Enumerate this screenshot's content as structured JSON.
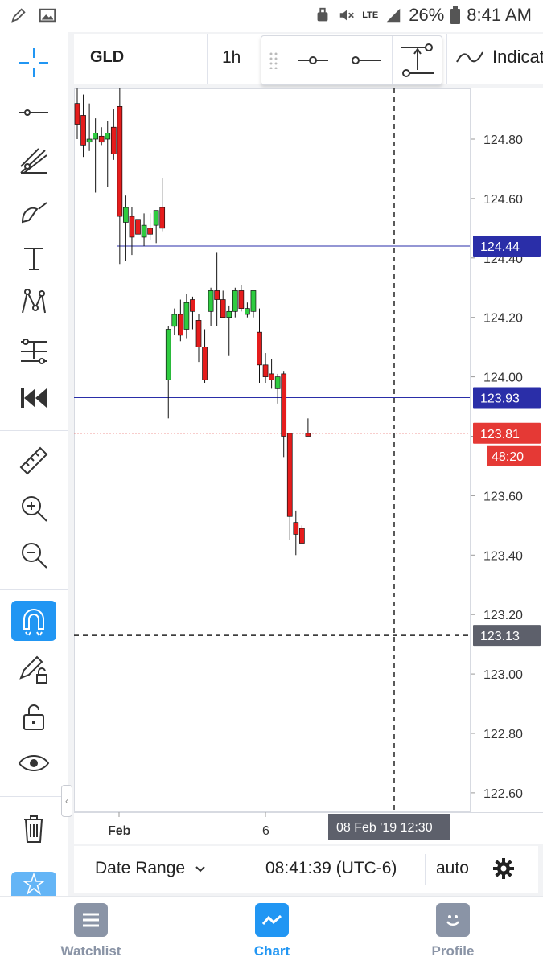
{
  "status_bar": {
    "battery": "26%",
    "time": "8:41 AM",
    "network": "LTE"
  },
  "top_toolbar": {
    "symbol": "GLD",
    "interval": "1h",
    "indicators_label": "Indicators"
  },
  "price_axis": {
    "ticks": [
      "124.80",
      "124.60",
      "124.40",
      "124.20",
      "124.00",
      "123.80",
      "123.60",
      "123.40",
      "123.20",
      "123.00",
      "122.80",
      "122.60"
    ],
    "labels": {
      "line_upper": "124.44",
      "line_lower": "123.93",
      "last_price": "123.81",
      "countdown": "48:20",
      "crosshair_price": "123.13"
    }
  },
  "time_axis": {
    "labels": [
      "Feb",
      "6"
    ],
    "crosshair_time": "08 Feb '19   12:30"
  },
  "chart_data": {
    "type": "candlestick",
    "symbol": "GLD",
    "interval": "1h",
    "ylim": [
      122.55,
      124.98
    ],
    "candles": [
      {
        "o": 124.92,
        "h": 124.97,
        "l": 124.8,
        "c": 124.85
      },
      {
        "o": 124.88,
        "h": 124.95,
        "l": 124.74,
        "c": 124.78
      },
      {
        "o": 124.79,
        "h": 124.92,
        "l": 124.76,
        "c": 124.8
      },
      {
        "o": 124.8,
        "h": 124.87,
        "l": 124.62,
        "c": 124.82
      },
      {
        "o": 124.81,
        "h": 124.84,
        "l": 124.78,
        "c": 124.79
      },
      {
        "o": 124.8,
        "h": 124.86,
        "l": 124.64,
        "c": 124.82
      },
      {
        "o": 124.84,
        "h": 124.9,
        "l": 124.73,
        "c": 124.75
      },
      {
        "o": 124.91,
        "h": 124.99,
        "l": 124.38,
        "c": 124.54
      },
      {
        "o": 124.52,
        "h": 124.61,
        "l": 124.39,
        "c": 124.57
      },
      {
        "o": 124.54,
        "h": 124.57,
        "l": 124.41,
        "c": 124.47
      },
      {
        "o": 124.53,
        "h": 124.59,
        "l": 124.43,
        "c": 124.48
      },
      {
        "o": 124.47,
        "h": 124.55,
        "l": 124.44,
        "c": 124.51
      },
      {
        "o": 124.5,
        "h": 124.55,
        "l": 124.46,
        "c": 124.48
      },
      {
        "o": 124.51,
        "h": 124.56,
        "l": 124.45,
        "c": 124.56
      },
      {
        "o": 124.57,
        "h": 124.67,
        "l": 124.49,
        "c": 124.5
      },
      {
        "o": 123.99,
        "h": 124.17,
        "l": 123.86,
        "c": 124.16
      },
      {
        "o": 124.17,
        "h": 124.23,
        "l": 124.14,
        "c": 124.21
      },
      {
        "o": 124.21,
        "h": 124.26,
        "l": 124.12,
        "c": 124.14
      },
      {
        "o": 124.16,
        "h": 124.28,
        "l": 124.13,
        "c": 124.25
      },
      {
        "o": 124.26,
        "h": 124.27,
        "l": 124.16,
        "c": 124.22
      },
      {
        "o": 124.19,
        "h": 124.21,
        "l": 124.05,
        "c": 124.1
      },
      {
        "o": 124.1,
        "h": 124.16,
        "l": 123.98,
        "c": 123.99
      },
      {
        "o": 124.22,
        "h": 124.3,
        "l": 124.17,
        "c": 124.29
      },
      {
        "o": 124.29,
        "h": 124.42,
        "l": 124.17,
        "c": 124.26
      },
      {
        "o": 124.26,
        "h": 124.29,
        "l": 124.21,
        "c": 124.2
      },
      {
        "o": 124.2,
        "h": 124.24,
        "l": 124.07,
        "c": 124.22
      },
      {
        "o": 124.22,
        "h": 124.3,
        "l": 124.2,
        "c": 124.29
      },
      {
        "o": 124.29,
        "h": 124.31,
        "l": 124.22,
        "c": 124.23
      },
      {
        "o": 124.21,
        "h": 124.25,
        "l": 124.2,
        "c": 124.23
      },
      {
        "o": 124.22,
        "h": 124.27,
        "l": 124.2,
        "c": 124.29
      },
      {
        "o": 124.15,
        "h": 124.23,
        "l": 123.98,
        "c": 124.04
      },
      {
        "o": 124.04,
        "h": 124.08,
        "l": 123.98,
        "c": 124.0
      },
      {
        "o": 124.01,
        "h": 124.06,
        "l": 123.96,
        "c": 123.99
      },
      {
        "o": 123.96,
        "h": 124.01,
        "l": 123.91,
        "c": 124.0
      },
      {
        "o": 124.01,
        "h": 124.02,
        "l": 123.73,
        "c": 123.8
      },
      {
        "o": 123.81,
        "h": 123.81,
        "l": 123.45,
        "c": 123.53
      },
      {
        "o": 123.51,
        "h": 123.55,
        "l": 123.4,
        "c": 123.47
      },
      {
        "o": 123.49,
        "h": 123.5,
        "l": 123.44,
        "c": 123.44
      },
      {
        "o": 123.81,
        "h": 123.86,
        "l": 123.8,
        "c": 123.8
      }
    ],
    "hlines": [
      {
        "price": 124.44,
        "color": "#2a2ea8",
        "label": "124.44"
      },
      {
        "price": 123.93,
        "color": "#2a2ea8",
        "label": "123.93"
      },
      {
        "price": 123.81,
        "color": "#e53935",
        "label": "123.81"
      }
    ],
    "crosshair": {
      "price": 123.13,
      "time": "08 Feb '19 12:30"
    },
    "x_labels": [
      "Feb",
      "6"
    ],
    "colors": {
      "up": "#2ecc40",
      "down": "#e51c1c",
      "accent": "#2196f3"
    }
  },
  "bottom_bar": {
    "date_range_label": "Date Range",
    "clock": "08:41:39 (UTC-6)",
    "scale_mode": "auto"
  },
  "bottom_nav": {
    "items": [
      {
        "label": "Watchlist",
        "icon": "list-icon"
      },
      {
        "label": "Chart",
        "icon": "chart-icon"
      },
      {
        "label": "Profile",
        "icon": "smiley-icon"
      }
    ]
  },
  "colors": {
    "accent": "#2196f3",
    "line_blue": "#2a2ea8",
    "price_red": "#e53935",
    "crosshair_label": "#5d606b"
  }
}
